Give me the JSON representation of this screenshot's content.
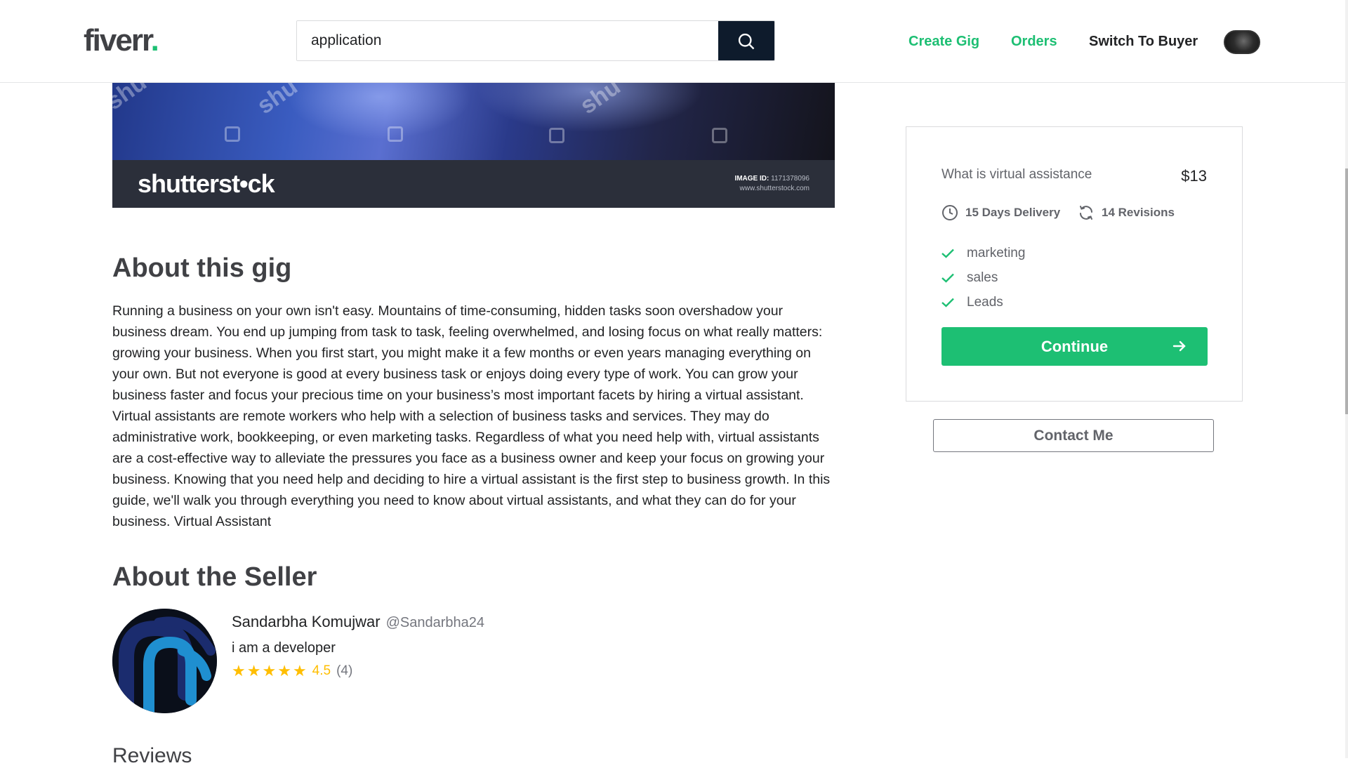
{
  "header": {
    "logo_text": "fiverr",
    "logo_dot": ".",
    "search_value": "application",
    "nav": {
      "create_gig": "Create Gig",
      "orders": "Orders",
      "switch_to_buyer": "Switch To Buyer"
    },
    "accent_color": "#1dbf73"
  },
  "banner": {
    "brand": "shutterst•ck",
    "image_id_label": "IMAGE ID:",
    "image_id_value": "1171378096",
    "site": "www.shutterstock.com",
    "watermark": "shu"
  },
  "about": {
    "heading": "About this gig",
    "description": "Running a business on your own isn't easy. Mountains of time-consuming, hidden tasks soon overshadow your business dream. You end up jumping from task to task, feeling overwhelmed, and losing focus on what really matters: growing your business. When you first start, you might make it a few months or even years managing everything on your own. But not everyone is good at every business task or enjoys doing every type of work. You can grow your business faster and focus your precious time on your business’s most important facets by hiring a virtual assistant. Virtual assistants are remote workers who help with a selection of business tasks and services. They may do administrative work, bookkeeping, or even marketing tasks. Regardless of what you need help with, virtual assistants are a cost-effective way to alleviate the pressures you face as a business owner and keep your focus on growing your business. Knowing that you need help and deciding to hire a virtual assistant is the first step to business growth. In this guide, we'll walk you through everything you need to know about virtual assistants, and what they can do for your business. Virtual Assistant"
  },
  "seller": {
    "heading": "About the Seller",
    "name": "Sandarbha Komujwar",
    "handle": "@Sandarbha24",
    "bio": "i am a developer",
    "rating": "4.5",
    "rating_count": "(4)",
    "stars": 5
  },
  "reviews": {
    "heading": "Reviews"
  },
  "package": {
    "title": "What is virtual assistance",
    "price": "$13",
    "delivery": "15 Days Delivery",
    "revisions": "14 Revisions",
    "features": [
      "marketing",
      "sales",
      "Leads"
    ],
    "continue_label": "Continue",
    "contact_label": "Contact Me"
  }
}
